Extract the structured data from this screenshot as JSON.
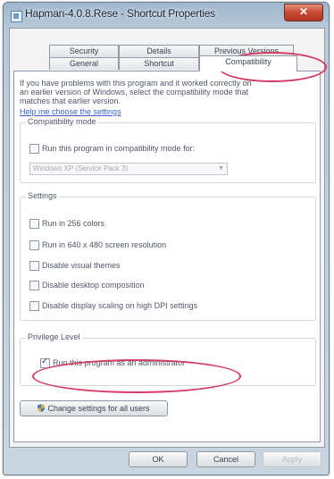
{
  "window": {
    "title": "Hapman-4.0.8.Rese - Shortcut Properties",
    "close_glyph": "✕"
  },
  "tabs": {
    "row_back": [
      "Security",
      "Details",
      "Previous Versions"
    ],
    "row_front": [
      "General",
      "Shortcut",
      "Compatibility"
    ],
    "active": "Compatibility"
  },
  "intro": {
    "line1": "If you have problems with this program and it worked correctly on",
    "line2": "an earlier version of Windows, select the compatibility mode that",
    "line3": "matches that earlier version.",
    "help_link": "Help me choose the settings"
  },
  "compat_mode": {
    "legend": "Compatibility mode",
    "checkbox_label": "Run this program in compatibility mode for:",
    "checked": false,
    "select_value": "Windows XP (Service Pack 3)"
  },
  "settings": {
    "legend": "Settings",
    "items": [
      {
        "label": "Run in 256 colors",
        "checked": false
      },
      {
        "label": "Run in 640 x 480 screen resolution",
        "checked": false
      },
      {
        "label": "Disable visual themes",
        "checked": false
      },
      {
        "label": "Disable desktop composition",
        "checked": false
      },
      {
        "label": "Disable display scaling on high DPI settings",
        "checked": false
      }
    ]
  },
  "privilege": {
    "legend": "Privilege Level",
    "checkbox_label": "Run this program as an administrator",
    "checked": true
  },
  "buttons": {
    "change_all": "Change settings for all users",
    "ok": "OK",
    "cancel": "Cancel",
    "apply": "Apply"
  },
  "annotation_color": "#d23a62"
}
